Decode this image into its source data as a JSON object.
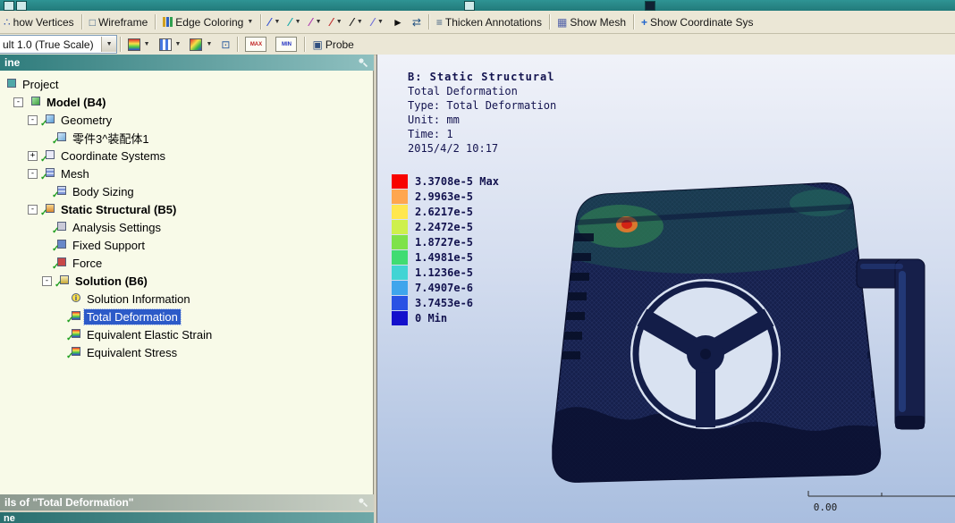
{
  "toolbar_graphics": {
    "show_vertices": "how Vertices",
    "wireframe": "Wireframe",
    "edge_coloring": "Edge Coloring",
    "thicken_annotations": "Thicken Annotations",
    "show_mesh": "Show Mesh",
    "show_coordinate": "Show Coordinate Sys"
  },
  "toolbar_result": {
    "scale_value": "ult 1.0 (True Scale)",
    "max": "MAX",
    "min": "MIN",
    "probe": "Probe"
  },
  "outline": {
    "header": "ine",
    "tree": [
      {
        "label": "Project"
      },
      {
        "label": "Model (B4)"
      },
      {
        "label": "Geometry"
      },
      {
        "label": "零件3^装配体1"
      },
      {
        "label": "Coordinate Systems"
      },
      {
        "label": "Mesh"
      },
      {
        "label": "Body Sizing"
      },
      {
        "label": "Static Structural (B5)"
      },
      {
        "label": "Analysis Settings"
      },
      {
        "label": "Fixed Support"
      },
      {
        "label": "Force"
      },
      {
        "label": "Solution (B6)"
      },
      {
        "label": "Solution Information"
      },
      {
        "label": "Total Deformation"
      },
      {
        "label": "Equivalent Elastic Strain"
      },
      {
        "label": "Equivalent Stress"
      }
    ]
  },
  "details": {
    "header": "ils of \"Total Deformation\"",
    "footer_strip": "ne"
  },
  "viewport": {
    "title": "B: Static Structural",
    "lines": [
      "Total Deformation",
      "Type: Total Deformation",
      "Unit: mm",
      "Time: 1",
      "2015/4/2 10:17"
    ],
    "legend": [
      {
        "label": "3.3708e-5 Max",
        "color": "#F80400"
      },
      {
        "label": "2.9963e-5",
        "color": "#FFA64F"
      },
      {
        "label": "2.6217e-5",
        "color": "#FFE74E"
      },
      {
        "label": "2.2472e-5",
        "color": "#CEF04C"
      },
      {
        "label": "1.8727e-5",
        "color": "#7EE249"
      },
      {
        "label": "1.4981e-5",
        "color": "#40DC72"
      },
      {
        "label": "1.1236e-5",
        "color": "#41D4D4"
      },
      {
        "label": "7.4907e-6",
        "color": "#3FA5EC"
      },
      {
        "label": "3.7453e-6",
        "color": "#2A52E4"
      },
      {
        "label": "0 Min",
        "color": "#1410CC"
      }
    ],
    "ruler_label": "0.00"
  }
}
